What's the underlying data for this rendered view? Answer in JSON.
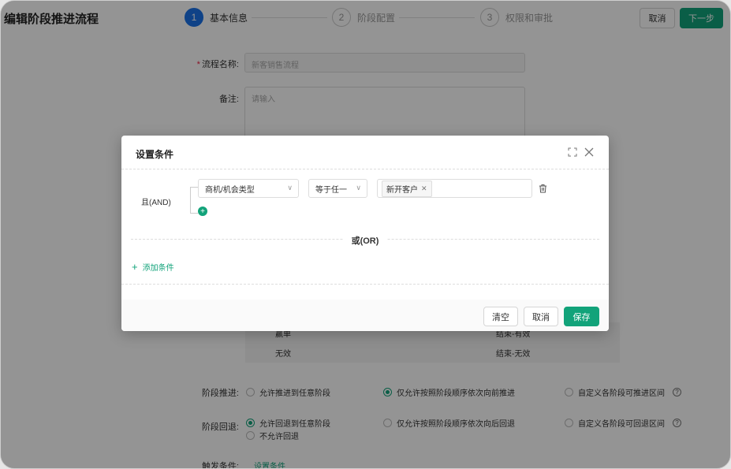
{
  "page": {
    "title": "编辑阶段推进流程",
    "steps": [
      {
        "num": "1",
        "label": "基本信息",
        "active": true
      },
      {
        "num": "2",
        "label": "阶段配置",
        "active": false
      },
      {
        "num": "3",
        "label": "权限和审批",
        "active": false
      }
    ],
    "cancel_label": "取消",
    "next_label": "下一步",
    "form": {
      "name_label": "流程名称:",
      "name_required": "*",
      "name_value": "新客销售流程",
      "note_label": "备注:",
      "note_placeholder": "请输入"
    },
    "table_rows": [
      {
        "c1": "赢单",
        "c2": "结束-有效"
      },
      {
        "c1": "无效",
        "c2": "结束-无效"
      }
    ],
    "advance": {
      "label": "阶段推进:",
      "options": [
        "允许推进到任意阶段",
        "仅允许按照阶段顺序依次向前推进",
        "自定义各阶段可推进区间"
      ],
      "selected": 1
    },
    "rollback": {
      "label": "阶段回退:",
      "options": [
        "允许回退到任意阶段",
        "仅允许按照阶段顺序依次向后回退",
        "自定义各阶段可回退区间",
        "不允许回退"
      ],
      "selected": 0
    },
    "trigger": {
      "label": "触发条件:",
      "link": "设置条件"
    },
    "help_glyph": "?"
  },
  "modal": {
    "title": "设置条件",
    "and_label": "且(AND)",
    "field_select": "商机/机会类型",
    "operator_select": "等于任一",
    "tag_value": "新开客户",
    "or_label": "或(OR)",
    "add_condition": "添加条件",
    "buttons": {
      "clear": "清空",
      "cancel": "取消",
      "save": "保存"
    }
  },
  "colors": {
    "brand": "#12a37a",
    "step_active": "#1a73e8"
  }
}
